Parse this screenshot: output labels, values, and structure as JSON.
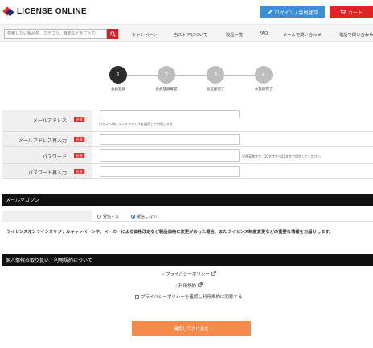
{
  "header": {
    "logo_text": "LICENSE ONLINE",
    "login_label": "ログイン / 会員登録",
    "cart_label": "カート"
  },
  "nav": {
    "search_placeholder": "検索したい製品名、カテゴリ、機能などをご入力",
    "items": [
      "キャンペーン",
      "当ストアについて",
      "製品一覧",
      "FAQ",
      "メールで問い合わせ",
      "電話で問い合わせ"
    ]
  },
  "steps": [
    {
      "number": "1",
      "label": "会員登録"
    },
    {
      "number": "2",
      "label": "会員登録確認"
    },
    {
      "number": "3",
      "label": "仮登録完了"
    },
    {
      "number": "4",
      "label": "本登録完了"
    }
  ],
  "form": {
    "required_badge": "必須",
    "email_label": "メールアドレス",
    "email_note": "ログイン時にメールアドレスを使用して利用します。",
    "email_confirm_label": "メールアドレス再入力",
    "password_label": "パスワード",
    "password_note": "半角英数字で、10文字から20文字で設定してください",
    "password_confirm_label": "パスワード再入力"
  },
  "mailmag": {
    "title": "メールマガジン",
    "option_yes": "受信する",
    "option_no": "受信しない",
    "selected": "受信しない",
    "description": "ライセンスオンラインオリジナルキャンペーンや、メーカーによる価格改定など製品価格に変更があった場合、またライセンス制度変更などの重要な情報をお届けします。"
  },
  "privacy": {
    "title": "個人情報の取り扱い・利用規約について",
    "privacy_link": "プライバシーポリシー",
    "terms_link": "利用規約",
    "agree_label": "プライバシーポリシーを確認し利用規約に同意する"
  },
  "submit_label": "確認して次に進む",
  "colors": {
    "accent_blue": "#3a8fd8",
    "cart_red": "#e02424",
    "section_black": "#111111",
    "submit_orange": "#f58a4b",
    "required_red": "#d32f2f"
  }
}
